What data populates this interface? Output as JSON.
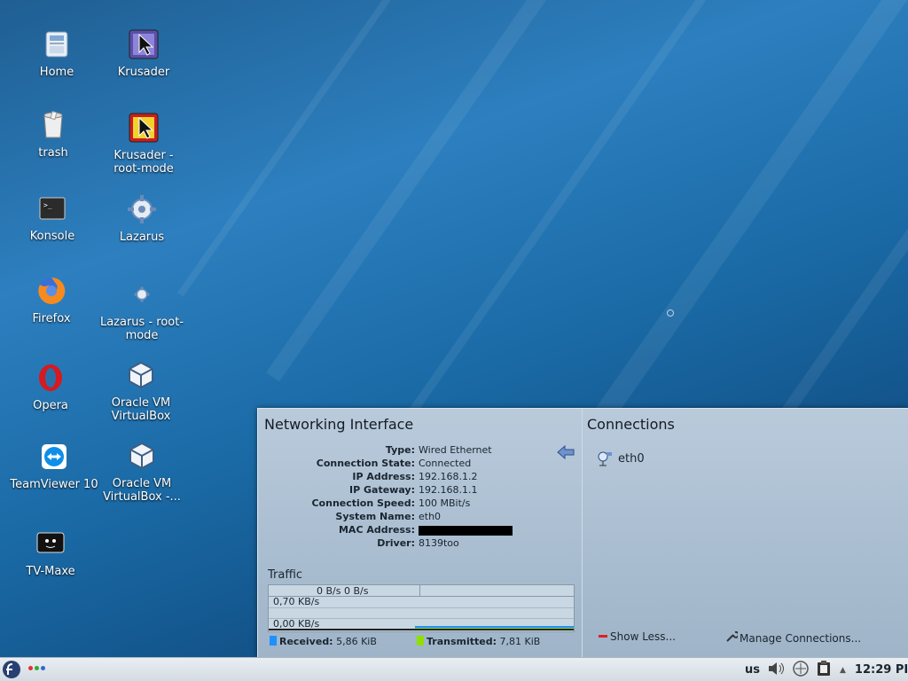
{
  "desktop": {
    "icons": [
      {
        "label": "Home",
        "icon": "home-folder-icon"
      },
      {
        "label": "Krusader",
        "icon": "krusader-icon"
      },
      {
        "label": "trash",
        "icon": "trash-icon"
      },
      {
        "label": "Krusader - root-mode",
        "icon": "krusader-root-icon"
      },
      {
        "label": "Konsole",
        "icon": "terminal-icon"
      },
      {
        "label": "Lazarus",
        "icon": "lazarus-icon"
      },
      {
        "label": "Firefox",
        "icon": "firefox-icon"
      },
      {
        "label": "Lazarus - root-mode",
        "icon": "lazarus-root-icon"
      },
      {
        "label": "Opera",
        "icon": "opera-icon"
      },
      {
        "label": "Oracle VM VirtualBox",
        "icon": "virtualbox-icon"
      },
      {
        "label": "TeamViewer 10",
        "icon": "teamviewer-icon"
      },
      {
        "label": "Oracle VM VirtualBox -...",
        "icon": "virtualbox-icon"
      },
      {
        "label": "TV-Maxe",
        "icon": "tv-icon"
      }
    ]
  },
  "network_popup": {
    "left_title": "Networking Interface",
    "info": [
      {
        "key": "Type:",
        "value": "Wired Ethernet"
      },
      {
        "key": "Connection State:",
        "value": "Connected"
      },
      {
        "key": "IP Address:",
        "value": "192.168.1.2"
      },
      {
        "key": "IP Gateway:",
        "value": "192.168.1.1"
      },
      {
        "key": "Connection Speed:",
        "value": "100 MBit/s"
      },
      {
        "key": "System Name:",
        "value": "eth0"
      },
      {
        "key": "MAC Address:",
        "value": ""
      },
      {
        "key": "Driver:",
        "value": "8139too"
      }
    ],
    "traffic": {
      "title": "Traffic",
      "header": "0 B/s 0 B/s",
      "upper_label": "0,70 KB/s",
      "lower_label": "0,00 KB/s",
      "received_label": "Received:",
      "received_value": "5,86 KiB",
      "transmitted_label": "Transmitted:",
      "transmitted_value": "7,81 KiB",
      "received_color": "#1e90ff",
      "transmitted_color": "#8ee000"
    },
    "right_title": "Connections",
    "connections": [
      {
        "name": "eth0"
      }
    ],
    "show_less_label": "Show Less...",
    "manage_label": "Manage Connections..."
  },
  "taskbar": {
    "keyboard_layout": "us",
    "clock": "12:29 PI"
  }
}
